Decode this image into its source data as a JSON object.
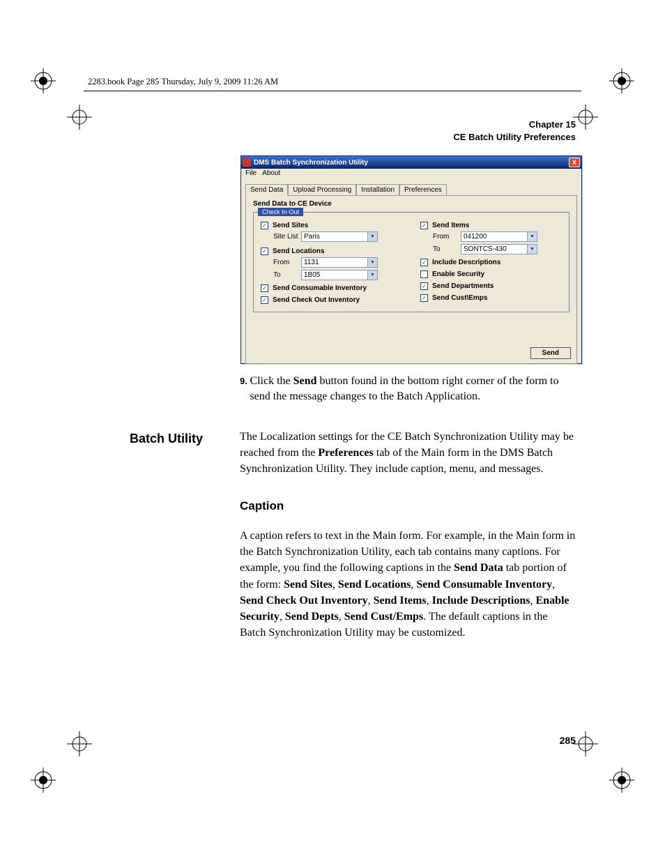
{
  "book_header": "2283.book  Page 285  Thursday, July 9, 2009  11:26 AM",
  "chapter": {
    "line1": "Chapter 15",
    "line2": "CE Batch Utility Preferences"
  },
  "app": {
    "title": "DMS Batch Synchronization Utility",
    "close_glyph": "X",
    "menu": {
      "file": "File",
      "about": "About"
    },
    "tabs": {
      "send_data": "Send Data",
      "upload": "Upload Processing",
      "install": "Installation",
      "prefs": "Preferences"
    },
    "panel_title": "Send Data to CE Device",
    "group_legend": "Check In-Out",
    "left": {
      "send_sites": "Send Sites",
      "site_list_label": "Site List",
      "site_list_value": "Paris",
      "send_locations": "Send Locations",
      "from_label": "From",
      "from_value": "1131",
      "to_label": "To",
      "to_value": "1B05",
      "send_consumable": "Send Consumable Inventory",
      "send_checkout": "Send Check Out Inventory"
    },
    "right": {
      "send_items": "Send Items",
      "from_label": "From",
      "from_value": "041200",
      "to_label": "To",
      "to_value": "SONTCS-430",
      "include_desc": "Include Descriptions",
      "enable_security": "Enable Security",
      "send_depts": "Send Departments",
      "send_cust": "Send Cust\\Emps"
    },
    "send_button": "Send"
  },
  "step": {
    "num": "9.",
    "text_pre": "Click the ",
    "send_bold": "Send",
    "text_post": " button found in the bottom right corner of the form to send the message changes to the Batch Application."
  },
  "batch_utility": {
    "heading": "Batch Utility",
    "p_pre": "The Localization settings for the CE Batch Synchronization Utility may be reached from the ",
    "prefs_bold": "Preferences",
    "p_post": " tab of the Main form in the DMS Batch Synchronization Utility. They include caption, menu, and messages."
  },
  "caption": {
    "heading": "Caption",
    "p1_pre": "A caption refers to text in the Main form. For example, in the Main form in the Batch Synchronization Utility, each tab contains many captions. For example, you find the following captions in the ",
    "send_data_bold": "Send Data",
    "p1_mid": " tab portion of the form: ",
    "b1": "Send Sites",
    "b2": "Send Locations",
    "b3": "Send Consumable Inventory",
    "b4": "Send Check Out Inventory",
    "b5": "Send Items",
    "b6": "Include Descriptions",
    "b7": "Enable Security",
    "b8": "Send Depts",
    "b9": "Send Cust/Emps",
    "p1_post": ". The default captions in the Batch Synchronization Utility may be customized."
  },
  "page_number": "285"
}
